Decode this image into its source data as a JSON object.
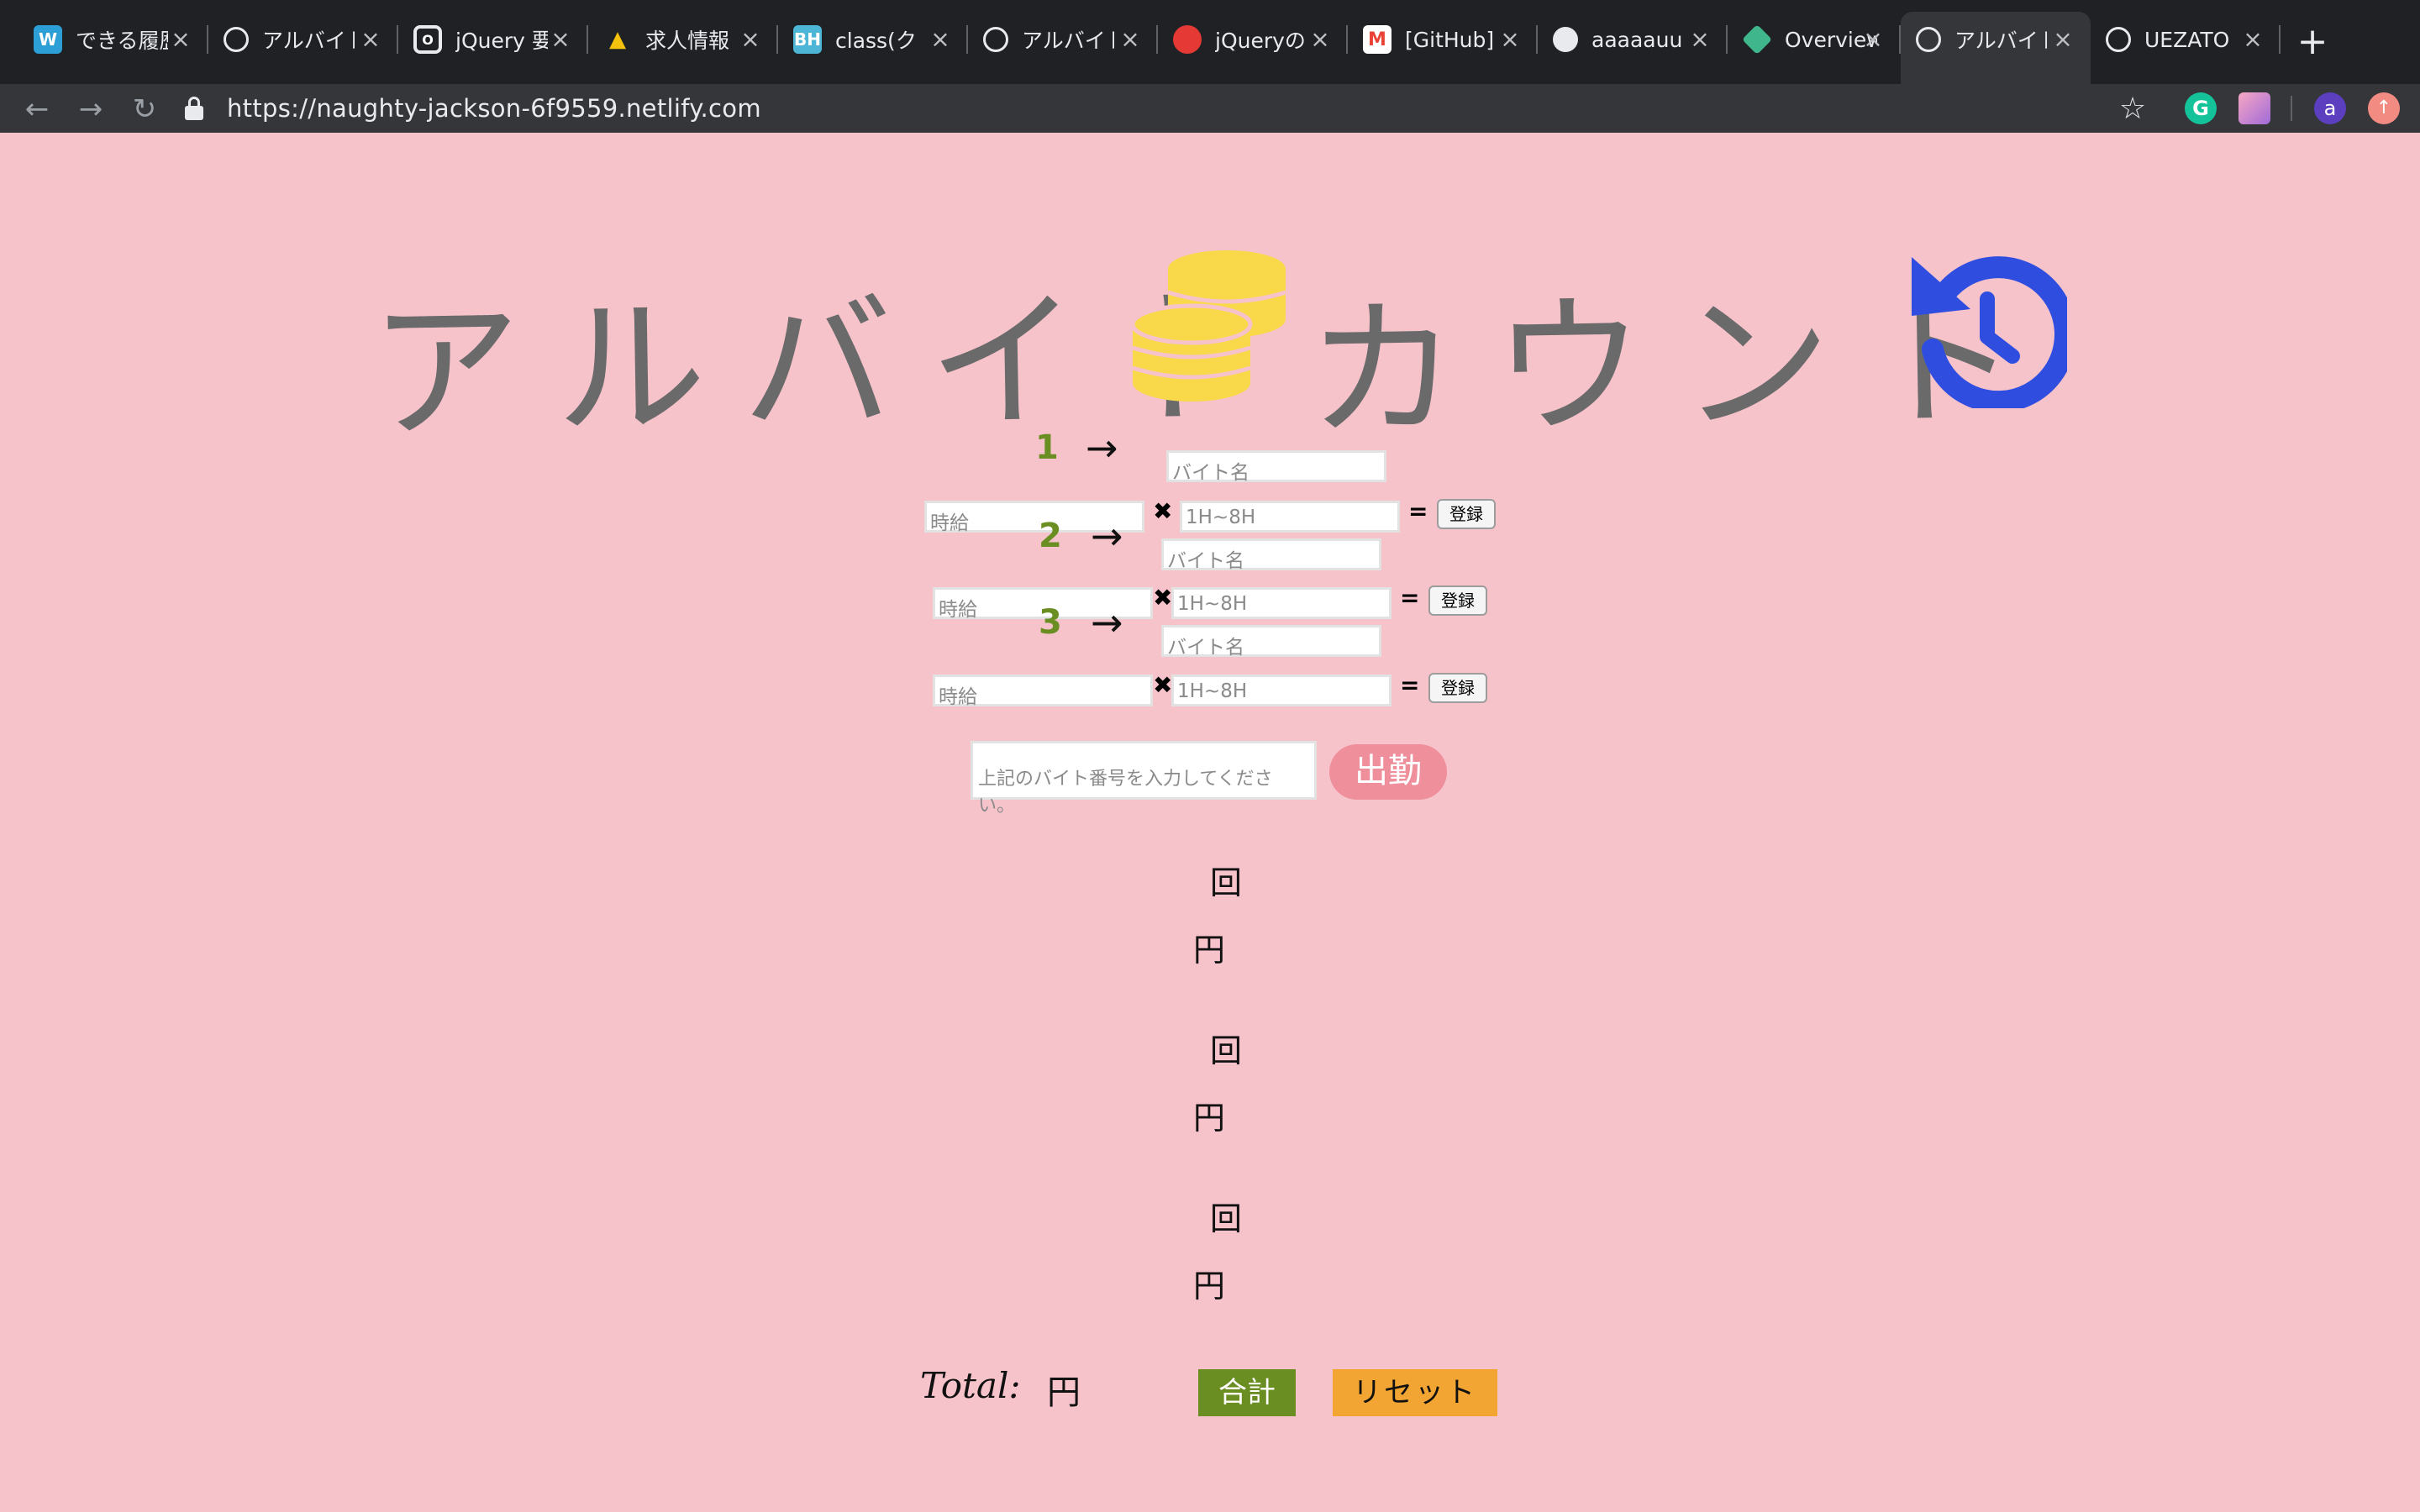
{
  "browser": {
    "tabs": [
      {
        "title": "できる履歴",
        "favicon": "W",
        "favicon_color": "#2b9fd6"
      },
      {
        "title": "アルバイト",
        "favicon": "globe",
        "favicon_color": "#e8eaed"
      },
      {
        "title": "jQuery 要",
        "favicon": "opera",
        "favicon_color": "#e8eaed"
      },
      {
        "title": "求人情報",
        "favicon": "triangle",
        "favicon_color": "#f4c20d"
      },
      {
        "title": "class(ク",
        "favicon": "BH",
        "favicon_color": "#4db6d6"
      },
      {
        "title": "アルバイト",
        "favicon": "globe",
        "favicon_color": "#e8eaed"
      },
      {
        "title": "jQueryの",
        "favicon": "red-sun",
        "favicon_color": "#e53935"
      },
      {
        "title": "[GitHub]",
        "favicon": "gmail",
        "favicon_color": "#ea4335"
      },
      {
        "title": "aaaaauu",
        "favicon": "github",
        "favicon_color": "#e8eaed"
      },
      {
        "title": "Overview",
        "favicon": "diamond",
        "favicon_color": "#3fb68b"
      },
      {
        "title": "アルバイト",
        "favicon": "globe",
        "favicon_color": "#e8eaed",
        "active": true
      },
      {
        "title": "UEZATO",
        "favicon": "globe",
        "favicon_color": "#e8eaed"
      }
    ],
    "url": "https://naughty-jackson-6f9559.netlify.com",
    "profile_initial": "a"
  },
  "app": {
    "title_left": "アルバイト",
    "title_right": "カウント",
    "jobs": [
      {
        "num": "1",
        "arrow": "→",
        "name_placeholder": "バイト名",
        "wage_placeholder": "時給",
        "hours_placeholder": "1H~8H",
        "times": "✖",
        "equals": "=",
        "register": "登録"
      },
      {
        "num": "2",
        "arrow": "→",
        "name_placeholder": "バイト名",
        "wage_placeholder": "時給",
        "hours_placeholder": "1H~8H",
        "times": "✖",
        "equals": "=",
        "register": "登録"
      },
      {
        "num": "3",
        "arrow": "→",
        "name_placeholder": "バイト名",
        "wage_placeholder": "時給",
        "hours_placeholder": "1H~8H",
        "times": "✖",
        "equals": "=",
        "register": "登録"
      }
    ],
    "shift_placeholder": "上記のバイト番号を入力してください。",
    "shift_button": "出勤",
    "results": [
      {
        "count_unit": "回",
        "yen_unit": "円"
      },
      {
        "count_unit": "回",
        "yen_unit": "円"
      },
      {
        "count_unit": "回",
        "yen_unit": "円"
      }
    ],
    "total_label": "Total:",
    "total_yen": "円",
    "sum_button": "合計",
    "reset_button": "リセット",
    "colors": {
      "background": "#f6c3cb",
      "coin": "#f9d84a",
      "history_icon": "#2f4ee0",
      "number": "#6b8e23",
      "shift_button": "#ef8f9c",
      "sum_button": "#6b8e23",
      "reset_button": "#f2a533"
    }
  }
}
